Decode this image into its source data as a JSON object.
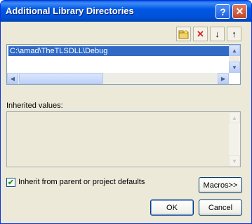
{
  "window": {
    "title": "Additional Library Directories",
    "help_glyph": "?",
    "close_glyph": "✕"
  },
  "toolbar": {
    "new_icon": "folder-new-icon",
    "delete_glyph": "✕",
    "down_glyph": "↓",
    "up_glyph": "↑"
  },
  "list": {
    "items": [
      "C:\\amad\\TheTLSDLL\\Debug"
    ]
  },
  "inherited": {
    "label": "Inherited values:"
  },
  "options": {
    "inherit_checked": true,
    "inherit_label": "Inherit from parent or project defaults",
    "macros_label": "Macros>>"
  },
  "buttons": {
    "ok": "OK",
    "cancel": "Cancel"
  }
}
